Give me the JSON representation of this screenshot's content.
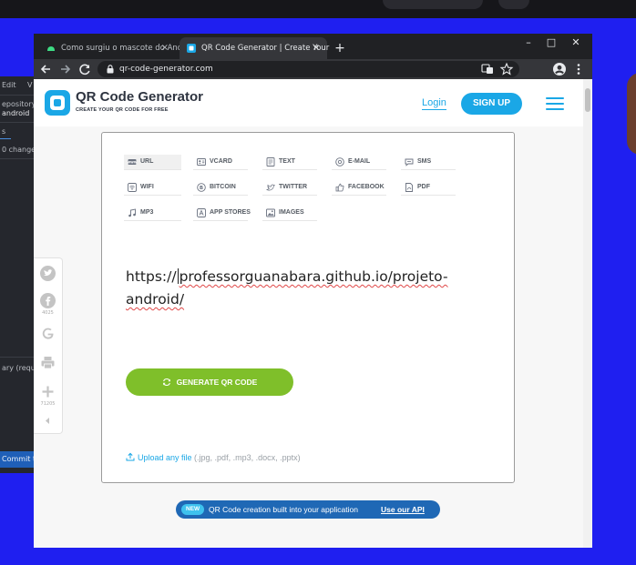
{
  "browser": {
    "tabs": [
      {
        "label": "Como surgiu o mascote do Andr",
        "active": false
      },
      {
        "label": "QR Code Generator | Create Your",
        "active": true
      }
    ],
    "new_tab": "+",
    "close_glyph": "×",
    "url": "qr-code-generator.com",
    "window_controls": {
      "minimize": "–",
      "maximize": "□",
      "close": "✕"
    }
  },
  "left_app": {
    "lines": [
      "Edit",
      "V",
      "epository",
      "android",
      "s",
      "0 change",
      "ary (requir"
    ],
    "commit_label": "Commit to"
  },
  "header": {
    "title": "QR Code Generator",
    "subtitle": "CREATE YOUR QR CODE FOR FREE",
    "login": "Login",
    "signup": "SIGN UP",
    "accent": "#1aa7e6"
  },
  "social": {
    "facebook_count": "4025",
    "plus_count": "71205"
  },
  "qr_types": [
    {
      "label": "URL",
      "icon": "url-icon",
      "active": true
    },
    {
      "label": "VCARD",
      "icon": "vcard-icon"
    },
    {
      "label": "TEXT",
      "icon": "text-icon"
    },
    {
      "label": "E-MAIL",
      "icon": "email-icon"
    },
    {
      "label": "SMS",
      "icon": "sms-icon"
    },
    {
      "label": "WIFI",
      "icon": "wifi-icon"
    },
    {
      "label": "BITCOIN",
      "icon": "bitcoin-icon"
    },
    {
      "label": "TWITTER",
      "icon": "twitter-icon"
    },
    {
      "label": "FACEBOOK",
      "icon": "facebook-icon"
    },
    {
      "label": "PDF",
      "icon": "pdf-icon"
    },
    {
      "label": "MP3",
      "icon": "mp3-icon"
    },
    {
      "label": "APP STORES",
      "icon": "app-stores-icon"
    },
    {
      "label": "IMAGES",
      "icon": "images-icon"
    }
  ],
  "input": {
    "line1_a": "https://",
    "line1_b": "professorguanabara.github.io/projeto-",
    "line2": "android/"
  },
  "generate": {
    "label": "GENERATE QR CODE",
    "color": "#7fbf2a"
  },
  "upload": {
    "link": "Upload any file",
    "formats": " (.jpg, .pdf, .mp3, .docx, .pptx)"
  },
  "banner": {
    "badge": "NEW",
    "message": "QR Code creation built into your application",
    "link": "Use our API"
  }
}
